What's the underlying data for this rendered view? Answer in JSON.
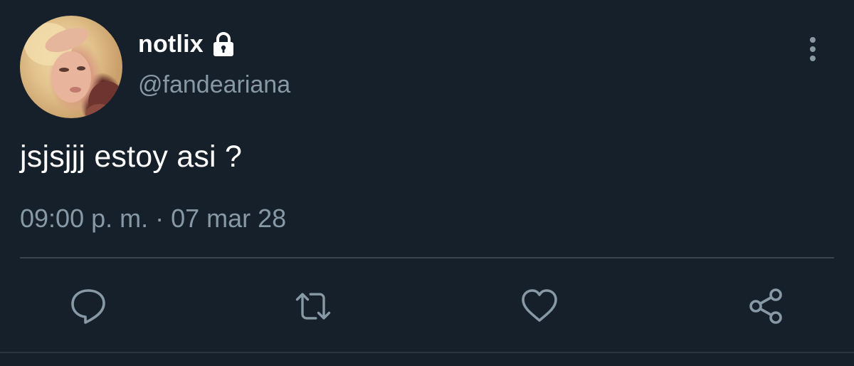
{
  "tweet": {
    "display_name": "notlix",
    "handle": "@fandeariana",
    "text": "jsjsjjj estoy asi ?",
    "timestamp": "09:00 p. m. · 07 mar 28"
  },
  "icons": {
    "lock": "lock-icon",
    "more": "more-vertical-icon",
    "reply": "reply-icon",
    "retweet": "retweet-icon",
    "like": "heart-icon",
    "share": "share-icon"
  },
  "colors": {
    "background": "#15202b",
    "primary_text": "#ffffff",
    "secondary_text": "#8899a6",
    "divider": "#38444d"
  }
}
